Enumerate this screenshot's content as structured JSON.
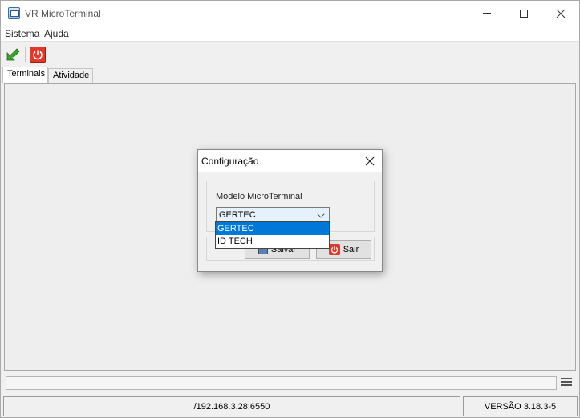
{
  "window": {
    "title": "VR MicroTerminal"
  },
  "menu": {
    "items": [
      "Sistema",
      "Ajuda"
    ]
  },
  "toolbar": {
    "buttons": [
      "enter-icon",
      "power-icon"
    ]
  },
  "tabs": [
    {
      "label": "Terminais",
      "active": true
    },
    {
      "label": "Atividade",
      "active": false
    }
  ],
  "status": {
    "address": "/192.168.3.28:6550",
    "version": "VERSÃO 3.18.3-5"
  },
  "dialog": {
    "title": "Configuração",
    "field_label": "Modelo MicroTerminal",
    "selected": "GERTEC",
    "options": [
      "GERTEC",
      "ID TECH"
    ],
    "save_label": "Salvar",
    "exit_label": "Sair"
  },
  "colors": {
    "accent": "#0078d7",
    "power": "#e0382b",
    "enter_arrow": "#3aa02e"
  }
}
